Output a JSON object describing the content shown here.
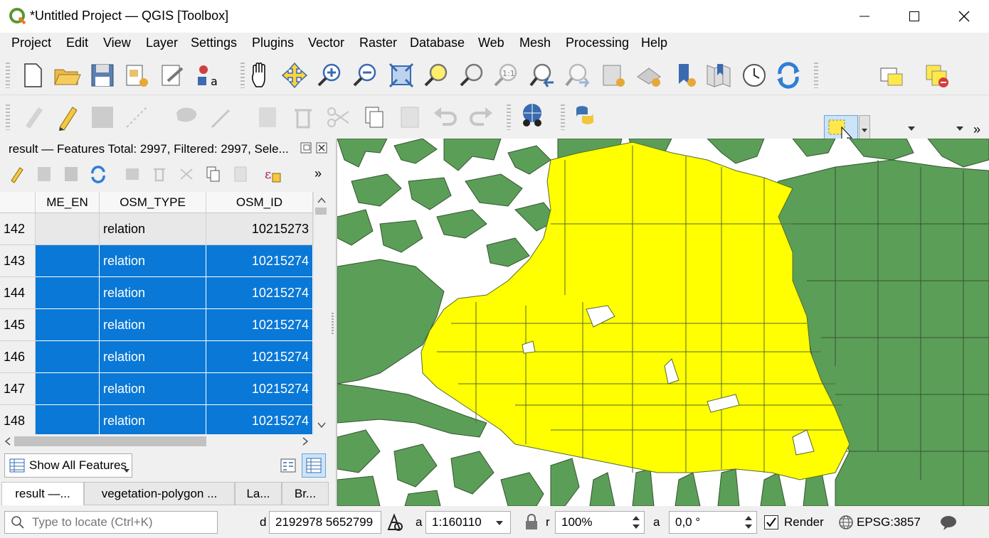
{
  "window": {
    "title": "*Untitled Project — QGIS [Toolbox]"
  },
  "menu": [
    "Project",
    "Edit",
    "View",
    "Layer",
    "Settings",
    "Plugins",
    "Vector",
    "Raster",
    "Database",
    "Web",
    "Mesh",
    "Processing",
    "Help"
  ],
  "attribute_table": {
    "title": "result — Features Total: 2997, Filtered: 2997, Sele...",
    "columns": [
      "ME_EN",
      "OSM_TYPE",
      "OSM_ID"
    ],
    "rows": [
      {
        "num": "142",
        "me_en": "",
        "osm_type": "relation",
        "osm_id": "10215273",
        "selected": false
      },
      {
        "num": "143",
        "me_en": "",
        "osm_type": "relation",
        "osm_id": "10215274",
        "selected": true
      },
      {
        "num": "144",
        "me_en": "",
        "osm_type": "relation",
        "osm_id": "10215274",
        "selected": true
      },
      {
        "num": "145",
        "me_en": "",
        "osm_type": "relation",
        "osm_id": "10215274",
        "selected": true
      },
      {
        "num": "146",
        "me_en": "",
        "osm_type": "relation",
        "osm_id": "10215274",
        "selected": true
      },
      {
        "num": "147",
        "me_en": "",
        "osm_type": "relation",
        "osm_id": "10215274",
        "selected": true
      },
      {
        "num": "148",
        "me_en": "",
        "osm_type": "relation",
        "osm_id": "10215274",
        "selected": true
      }
    ],
    "show_all_label": "Show All Features",
    "more": "»"
  },
  "bottom_tabs": [
    "result —...",
    "vegetation-polygon ...",
    "La...",
    "Br..."
  ],
  "status": {
    "locate_placeholder": "Type to locate (Ctrl+K)",
    "coord_label": "d",
    "coordinate": "2192978  5652799",
    "scale_label": "a",
    "scale": "1:160110",
    "mag_label": "r",
    "magnifier": "100%",
    "rot_label": "a",
    "rotation": "0,0 °",
    "render_label": "Render",
    "crs": "EPSG:3857"
  },
  "colors": {
    "selection": "#0a78d7",
    "selected_feature": "#ffff00",
    "vegetation": "#5b9e58",
    "outline": "#3a5a30"
  }
}
